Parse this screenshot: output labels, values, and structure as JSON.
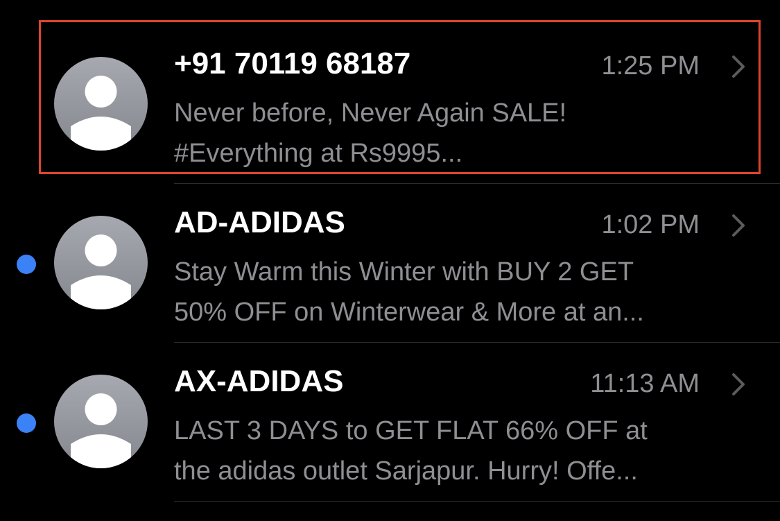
{
  "colors": {
    "background": "#000000",
    "unread_dot": "#3b82f6",
    "highlight_border": "#e0432f",
    "secondary_text": "#8e8e93"
  },
  "messages": [
    {
      "sender": "+91 70119 68187",
      "time": "1:25 PM",
      "preview_line1": "Never before, Never Again SALE!",
      "preview_line2": "#Everything at Rs9995...",
      "unread": false,
      "highlighted": true,
      "avatar_icon": "person-silhouette-icon",
      "chevron_icon": "chevron-right-icon"
    },
    {
      "sender": "AD-ADIDAS",
      "time": "1:02 PM",
      "preview_line1": "Stay Warm this Winter with BUY 2 GET",
      "preview_line2": "50% OFF on Winterwear & More at an...",
      "unread": true,
      "highlighted": false,
      "avatar_icon": "person-silhouette-icon",
      "chevron_icon": "chevron-right-icon"
    },
    {
      "sender": "AX-ADIDAS",
      "time": "11:13 AM",
      "preview_line1": "LAST 3 DAYS to GET FLAT 66% OFF at",
      "preview_line2": "the adidas outlet Sarjapur. Hurry! Offe...",
      "unread": true,
      "highlighted": false,
      "avatar_icon": "person-silhouette-icon",
      "chevron_icon": "chevron-right-icon"
    }
  ]
}
